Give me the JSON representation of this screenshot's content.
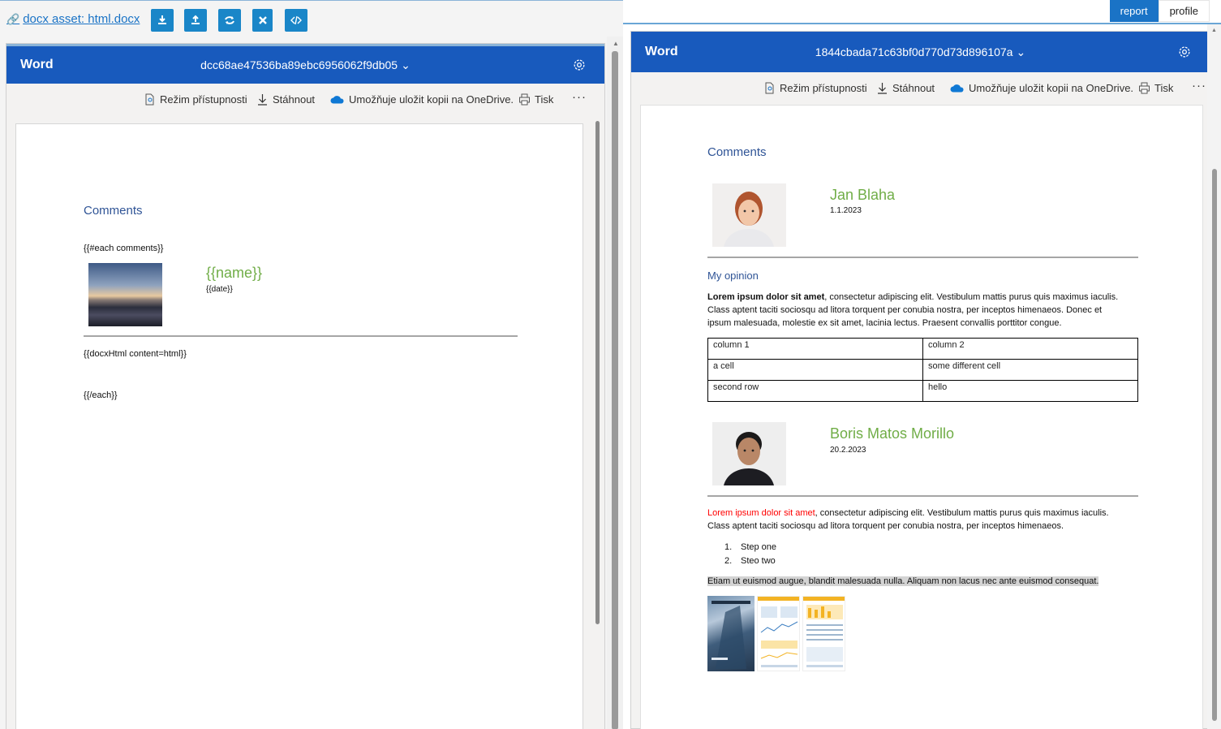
{
  "left_pane": {
    "asset_link": "docx asset: html.docx",
    "toolbar_icons": [
      "download-icon",
      "upload-icon",
      "refresh-icon",
      "close-icon",
      "code-icon"
    ],
    "word": {
      "brand": "Word",
      "doc_id": "dcc68ae47536ba89ebc6956062f9db05",
      "commands": [
        "Režim přístupnosti",
        "Stáhnout",
        "Umožňuje uložit kopii na OneDrive.",
        "Tisk"
      ],
      "page": {
        "heading": "Comments",
        "each_open": "{{#each comments}}",
        "name_placeholder": "{{name}}",
        "date_placeholder": "{{date}}",
        "html_placeholder": "{{docxHtml content=html}}",
        "each_close": "{{/each}}"
      }
    }
  },
  "right_pane": {
    "tabs": [
      {
        "label": "report",
        "active": true
      },
      {
        "label": "profile",
        "active": false
      }
    ],
    "word": {
      "brand": "Word",
      "doc_id": "1844cbada71c63bf0d770d73d896107a",
      "commands": [
        "Režim přístupnosti",
        "Stáhnout",
        "Umožňuje uložit kopii na OneDrive.",
        "Tisk"
      ],
      "page": {
        "heading": "Comments",
        "comments": [
          {
            "name": "Jan Blaha",
            "date": "1.1.2023",
            "subheading": "My opinion",
            "para_bold": "Lorem ipsum dolor sit amet",
            "para_rest_line1": ", consectetur adipiscing elit. Vestibulum mattis purus quis maximus iaculis.",
            "para_line2": "Class aptent taciti sociosqu ad litora torquent per conubia nostra, per inceptos himenaeos. Donec et",
            "para_line3": "ipsum malesuada, molestie ex sit amet, lacinia lectus. Praesent convallis porttitor congue.",
            "table": [
              [
                "column 1",
                "column 2"
              ],
              [
                "a cell",
                "some different cell"
              ],
              [
                "second row",
                "hello"
              ]
            ]
          },
          {
            "name": "Boris Matos Morillo",
            "date": "20.2.2023",
            "para_red": "Lorem ipsum dolor sit amet",
            "para_rest_line1": ", consectetur adipiscing elit. Vestibulum mattis purus quis maximus iaculis.",
            "para_line2": "Class aptent taciti sociosqu ad litora torquent per conubia nostra, per inceptos himenaeos.",
            "list": [
              "Step one",
              "Steo two"
            ],
            "highlight": "Etiam ut euismod augue, blandit malesuada nulla. Aliquam non lacus nec ante euismod consequat."
          }
        ]
      }
    }
  },
  "colors": {
    "word_blue": "#185abd",
    "toolbar_button": "#1a86c8",
    "heading_blue": "#2f5496",
    "name_green": "#70ad47",
    "red_text": "#ff0000",
    "tab_active": "#1a73c6"
  }
}
